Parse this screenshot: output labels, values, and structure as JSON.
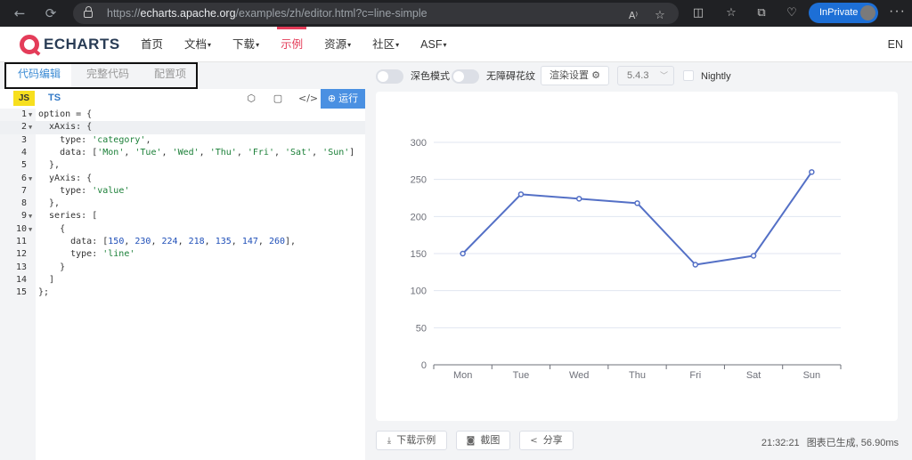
{
  "browser": {
    "back_icon": "←",
    "reload_icon": "⟳",
    "url_prefix": "https://",
    "url_host": "echarts.apache.org",
    "url_path": "/examples/zh/editor.html?c=line-simple",
    "inprivate_label": "InPrivate"
  },
  "header": {
    "logo_text": "ECHARTS",
    "nav": [
      {
        "label": "首页"
      },
      {
        "label": "文档",
        "caret": "▾"
      },
      {
        "label": "下载",
        "caret": "▾"
      },
      {
        "label": "示例"
      },
      {
        "label": "资源",
        "caret": "▾"
      },
      {
        "label": "社区",
        "caret": "▾"
      },
      {
        "label": "ASF",
        "caret": "▾"
      }
    ],
    "lang": "EN"
  },
  "editor": {
    "tabs": [
      "代码编辑",
      "完整代码",
      "配置项"
    ],
    "lang_js": "JS",
    "lang_ts": "TS",
    "run_label": "运行",
    "run_icon": "⊕"
  },
  "controls": {
    "dark_mode_label": "深色模式",
    "decal_label": "无障碍花纹",
    "render_settings_label": "渲染设置 ⚙",
    "version": "5.4.3",
    "nightly_label": "Nightly"
  },
  "footer": {
    "download_label": "下载示例",
    "screenshot_label": "截图",
    "share_label": "分享",
    "time": "21:32:21",
    "status_text": "图表已生成, 56.90ms"
  },
  "colors": {
    "series": "#5470c6",
    "axis_label": "#6e7079",
    "split_line": "#e0e6f1",
    "brand": "#e43c59"
  },
  "chart_data": {
    "type": "line",
    "categories": [
      "Mon",
      "Tue",
      "Wed",
      "Thu",
      "Fri",
      "Sat",
      "Sun"
    ],
    "values": [
      150,
      230,
      224,
      218,
      135,
      147,
      260
    ],
    "yticks": [
      "0",
      "50",
      "100",
      "150",
      "200",
      "250",
      "300"
    ],
    "ylim": [
      0,
      300
    ],
    "grid": true,
    "legend": false
  }
}
